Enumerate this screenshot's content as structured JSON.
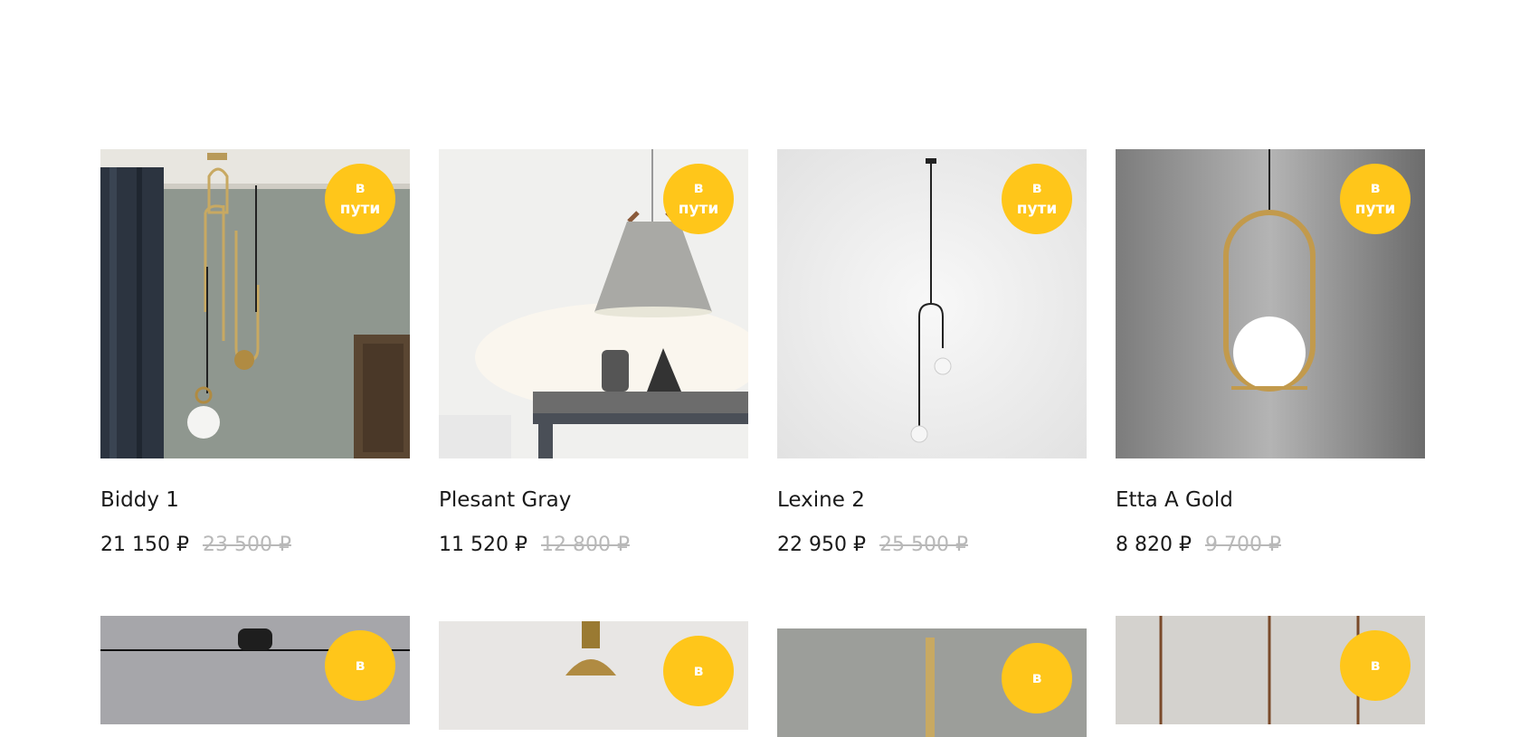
{
  "badge_text": "в пути",
  "colors": {
    "badge": "#ffc61a",
    "old_price": "#b8b8b8",
    "text": "#1a1a1a"
  },
  "products": [
    {
      "name": "Biddy 1",
      "price": "21 150 ₽",
      "old_price": "23 500 ₽",
      "badge": "в пути"
    },
    {
      "name": "Plesant Gray",
      "price": "11 520 ₽",
      "old_price": "12 800 ₽",
      "badge": "в пути"
    },
    {
      "name": "Lexine 2",
      "price": "22 950 ₽",
      "old_price": "25 500 ₽",
      "badge": "в пути"
    },
    {
      "name": "Etta A Gold",
      "price": "8 820 ₽",
      "old_price": "9 700 ₽",
      "badge": "в пути"
    }
  ],
  "products_row2": [
    {
      "badge": "в"
    },
    {
      "badge": "в"
    },
    {
      "badge": "в"
    },
    {
      "badge": "в"
    }
  ]
}
